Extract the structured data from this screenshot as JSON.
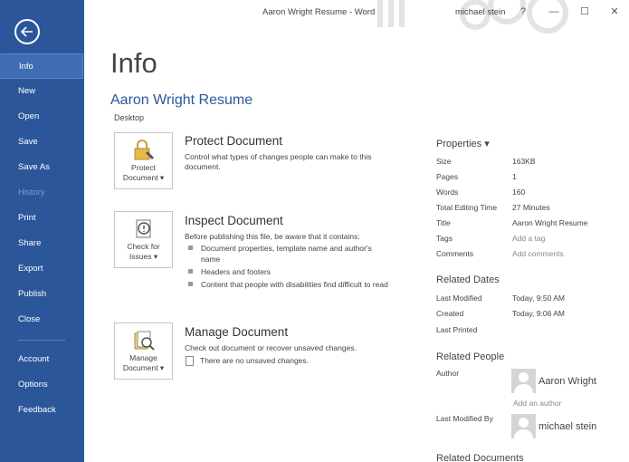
{
  "window": {
    "title": "Aaron Wright Resume - Word",
    "user": "michael stein",
    "help": "?",
    "minimize": "—",
    "restore": "☐",
    "close": "✕"
  },
  "sidebar": {
    "items": [
      {
        "label": "Info"
      },
      {
        "label": "New"
      },
      {
        "label": "Open"
      },
      {
        "label": "Save"
      },
      {
        "label": "Save As"
      },
      {
        "label": "History"
      },
      {
        "label": "Print"
      },
      {
        "label": "Share"
      },
      {
        "label": "Export"
      },
      {
        "label": "Publish"
      },
      {
        "label": "Close"
      },
      {
        "label": "Account"
      },
      {
        "label": "Options"
      },
      {
        "label": "Feedback"
      }
    ]
  },
  "main": {
    "page_title": "Info",
    "doc_title": "Aaron Wright Resume",
    "doc_location": "Desktop",
    "protect": {
      "tile_line1": "Protect",
      "tile_line2": "Document ▾",
      "title": "Protect Document",
      "desc": "Control what types of changes people can make to this document."
    },
    "inspect": {
      "tile_line1": "Check for",
      "tile_line2": "Issues ▾",
      "title": "Inspect Document",
      "desc": "Before publishing this file, be aware that it contains:",
      "bullets": [
        "Document properties, template name and author's name",
        "Headers and footers",
        "Content that people with disabilities find difficult to read"
      ]
    },
    "manage": {
      "tile_line1": "Manage",
      "tile_line2": "Document ▾",
      "title": "Manage Document",
      "desc": "Check out document or recover unsaved changes.",
      "unsaved": "There are no unsaved changes."
    }
  },
  "properties": {
    "header": "Properties ▾",
    "rows": [
      {
        "key": "Size",
        "value": "163KB"
      },
      {
        "key": "Pages",
        "value": "1"
      },
      {
        "key": "Words",
        "value": "160"
      },
      {
        "key": "Total Editing Time",
        "value": "27 Minutes"
      },
      {
        "key": "Title",
        "value": "Aaron Wright Resume"
      },
      {
        "key": "Tags",
        "value": "Add a tag"
      },
      {
        "key": "Comments",
        "value": "Add comments"
      }
    ],
    "related_dates": {
      "title": "Related Dates",
      "rows": [
        {
          "key": "Last Modified",
          "value": "Today, 9:50 AM"
        },
        {
          "key": "Created",
          "value": "Today, 9:06 AM"
        },
        {
          "key": "Last Printed",
          "value": ""
        }
      ]
    },
    "related_people": {
      "title": "Related People",
      "author_label": "Author",
      "author_name": "Aaron Wright",
      "add_author": "Add an author",
      "modified_by_label": "Last Modified By",
      "modified_by_name": "michael stein"
    },
    "related_documents": {
      "title": "Related Documents"
    }
  },
  "colors": {
    "sidebar": "#2b579a",
    "accent": "#2b579a"
  }
}
